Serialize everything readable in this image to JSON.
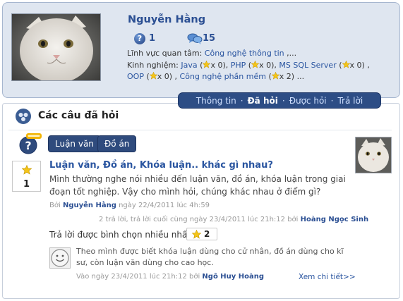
{
  "profile": {
    "name": "Nguyễn Hằng",
    "questions_count": "1",
    "answers_count": "15",
    "interest_label": "Lĩnh vực quan tâm:",
    "interest_value": "Công nghệ thông tin",
    "interest_more": ",...",
    "experience_label": "Kinh nghiệm:",
    "skills": [
      {
        "name": "Java",
        "count": "x 0"
      },
      {
        "name": "PHP",
        "count": "x 0"
      },
      {
        "name": "MS SQL Server",
        "count": "x 0"
      },
      {
        "name": "OOP",
        "count": "x 0"
      },
      {
        "name": "Công nghệ phần mềm",
        "count": "x 2"
      }
    ],
    "skills_more": "..."
  },
  "tabs": [
    {
      "label": "Thông tin",
      "active": false
    },
    {
      "label": "Đã hỏi",
      "active": true
    },
    {
      "label": "Được hỏi",
      "active": false
    },
    {
      "label": "Trả lời",
      "active": false
    }
  ],
  "tab_separator": "·",
  "section": {
    "title": "Các câu đã hỏi"
  },
  "question": {
    "tags": [
      "Luận văn",
      "Đồ án"
    ],
    "votes": "1",
    "title": "Luận văn, Đồ án, Khóa luận.. khác gì nhau?",
    "body": "Mình thường nghe nói nhiều đến luận văn, đồ án, khóa luận trong giai đoạn tốt nghiệp. Vậy cho mình hỏi, chúng khác nhau ở điểm gì?",
    "by_prefix": "Bởi",
    "author": "Nguyễn Hằng",
    "date_text": "ngày 22/4/2011 lúc 4h:59",
    "replies_text": "2 trả lời, trả lời cuối cùng ngày 23/4/2011 lúc 21h:12 bởi",
    "last_replier": "Hoàng Ngọc Sinh"
  },
  "best_answer": {
    "label": "Trả lời được bình chọn nhiều nhất:",
    "votes": "2",
    "text": "Theo mình được biết khóa luận dùng cho cử nhân, đồ án dùng cho kĩ sư, còn luận văn dùng cho cao học.",
    "meta_text": "Vào ngày 23/4/2011 lúc 21h:12 bởi",
    "author": "Ngô Huy Hoàng",
    "more_label": "Xem chi tiết>>"
  },
  "colors": {
    "accent": "#2b4f93",
    "tab_bg": "#2d4d85",
    "card_bg": "#dfe6f0",
    "link": "#2a55a0",
    "star": "#f5c518"
  },
  "icons": [
    "question-icon",
    "answers-icon",
    "star-icon",
    "section-icon",
    "help-badge-icon",
    "smiley-avatar-icon"
  ]
}
